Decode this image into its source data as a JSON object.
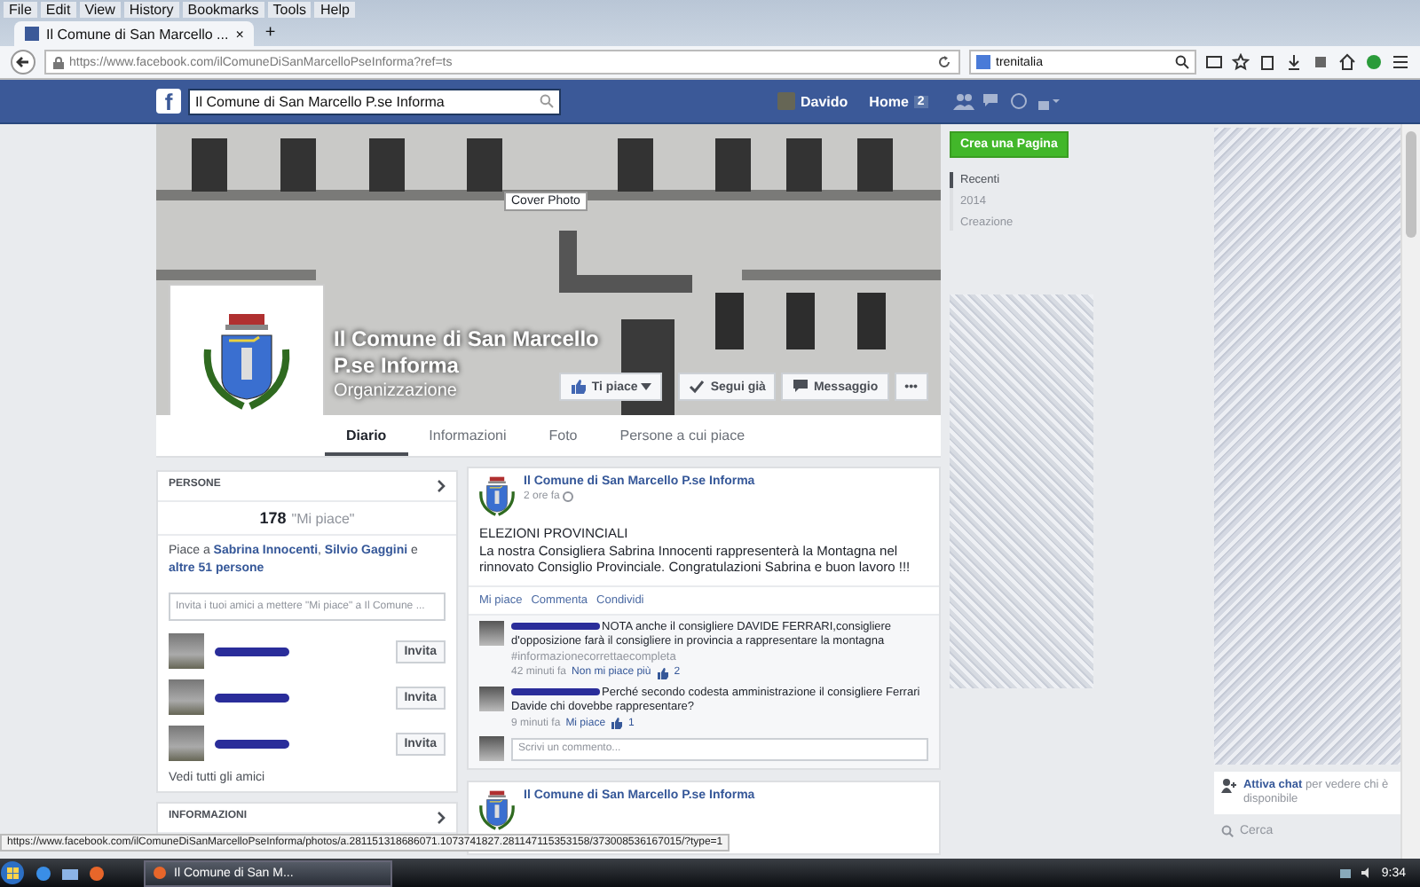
{
  "browser": {
    "menu": [
      "File",
      "Edit",
      "View",
      "History",
      "Bookmarks",
      "Tools",
      "Help"
    ],
    "tab": {
      "title": "Il Comune di San Marcello ...",
      "close": "×",
      "selected": true
    },
    "new_tab": "+",
    "url": "https://www.facebook.com/ilComuneDiSanMarcelloPseInforma?ref=ts",
    "search": "trenitalia"
  },
  "fb_bar": {
    "logo": "f",
    "search": "Il Comune di San Marcello P.se Informa",
    "user": "Davido",
    "home": "Home",
    "home_count": "2"
  },
  "cover": {
    "tooltip": "Cover Photo",
    "name": "Il Comune di San Marcello P.se Informa",
    "category": "Organizzazione",
    "actions": [
      {
        "label": "Ti piace",
        "kind": "like"
      },
      {
        "label": "Segui già",
        "kind": "follow"
      },
      {
        "label": "Messaggio",
        "kind": "message"
      },
      {
        "label": "•••",
        "kind": "more"
      }
    ]
  },
  "page_tabs": [
    {
      "label": "Diario",
      "selected": true
    },
    {
      "label": "Informazioni",
      "selected": false
    },
    {
      "label": "Foto",
      "selected": false
    },
    {
      "label": "Persone a cui piace",
      "selected": false
    }
  ],
  "people": {
    "title": "PERSONE",
    "likes_count": "178",
    "likes_label": "\"Mi piace\"",
    "liked_by": "Piace a **Sabrina Innocenti**, **Silvio Gaggini** e **altre 51 persone**",
    "invite_placeholder": "Invita i tuoi amici a mettere \"Mi piace\" a Il Comune ...",
    "friends": [
      {
        "button": "Invita"
      },
      {
        "button": "Invita"
      },
      {
        "button": "Invita"
      }
    ],
    "see_all": "Vedi tutti gli amici"
  },
  "info": {
    "title": "INFORMAZIONI"
  },
  "post": {
    "author": "Il Comune di San Marcello P.se Informa",
    "time": "2 ore fa",
    "title": "ELEZIONI PROVINCIALI",
    "text": "La nostra Consigliera Sabrina Innocenti rappresenterà la Montagna nel rinnovato Consiglio Provinciale. Congratulazioni Sabrina e buon lavoro !!!",
    "actions": [
      "Mi piace",
      "Commenta",
      "Condividi"
    ],
    "comments": [
      {
        "text": "NOTA anche il consigliere DAVIDE FERRARI,consigliere d'opposizione farà il consigliere in provincia a rappresentare la montagna",
        "hashtag": "#informazionecorrettaecompleta",
        "time": "42 minuti fa",
        "like": "Non mi piace più",
        "likes": "2"
      },
      {
        "text": "Perché secondo codesta amministrazione il consigliere Ferrari Davide chi dovebbe rappresentare?",
        "time": "9 minuti fa",
        "like": "Mi piace",
        "likes": "1"
      }
    ],
    "comment_placeholder": "Scrivi un commento..."
  },
  "post2": {
    "author": "Il Comune di San Marcello P.se Informa"
  },
  "right": {
    "create_page": "Crea una Pagina",
    "timeline": [
      {
        "label": "Recenti",
        "selected": true
      },
      {
        "label": "2014",
        "selected": false
      },
      {
        "label": "Creazione",
        "selected": false
      }
    ]
  },
  "chat": {
    "activate": "**Attiva chat** per vedere chi è disponibile",
    "search_placeholder": "Cerca"
  },
  "status_url": "https://www.facebook.com/ilComuneDiSanMarcelloPseInforma/photos/a.281151318686071.1073741827.281147115353158/373008536167015/?type=1",
  "taskbar": {
    "window": "Il Comune di San M...",
    "time": "9:34"
  }
}
